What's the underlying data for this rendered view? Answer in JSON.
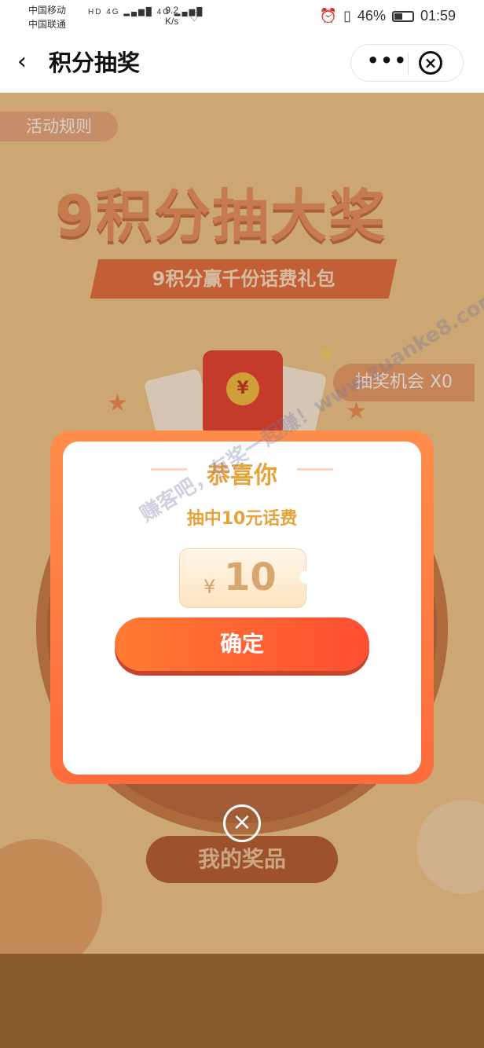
{
  "status_bar": {
    "carrier1": "中国移动",
    "carrier2": "中国联通",
    "signal_icons": "HD 4G ▂▄▆█ 4G ▂▄▆█",
    "net_speed_value": "9.2",
    "net_speed_unit": "K/s",
    "battery_percent": "46%",
    "battery_level": 0.46,
    "time": "01:59"
  },
  "nav": {
    "title": "积分抽奖",
    "more_label": "•••",
    "close_glyph": "×"
  },
  "page": {
    "rules_label": "活动规则",
    "big_title": "9积分抽大奖",
    "subtitle": "9积分赢千份话费礼包",
    "chances_label": "抽奖机会 X0",
    "my_prizes_label": "我的奖品",
    "redpacket_coin": "¥"
  },
  "modal": {
    "title": "恭喜你",
    "subtitle": "抽中10元话费",
    "currency": "¥",
    "amount": "10",
    "confirm_label": "确定",
    "watermark": "赚客吧，有奖一起赚！www.zuanke8.com",
    "close_glyph": "×"
  },
  "colors": {
    "accent": "#ff5a34",
    "gold_text": "#e9a23a",
    "modal_frame": "#ff7b3f"
  },
  "icons": [
    "back-arrow-icon",
    "more-icon",
    "close-circle-icon",
    "alarm-icon",
    "vibrate-icon",
    "wifi-icon",
    "heart-icon",
    "battery-icon"
  ]
}
